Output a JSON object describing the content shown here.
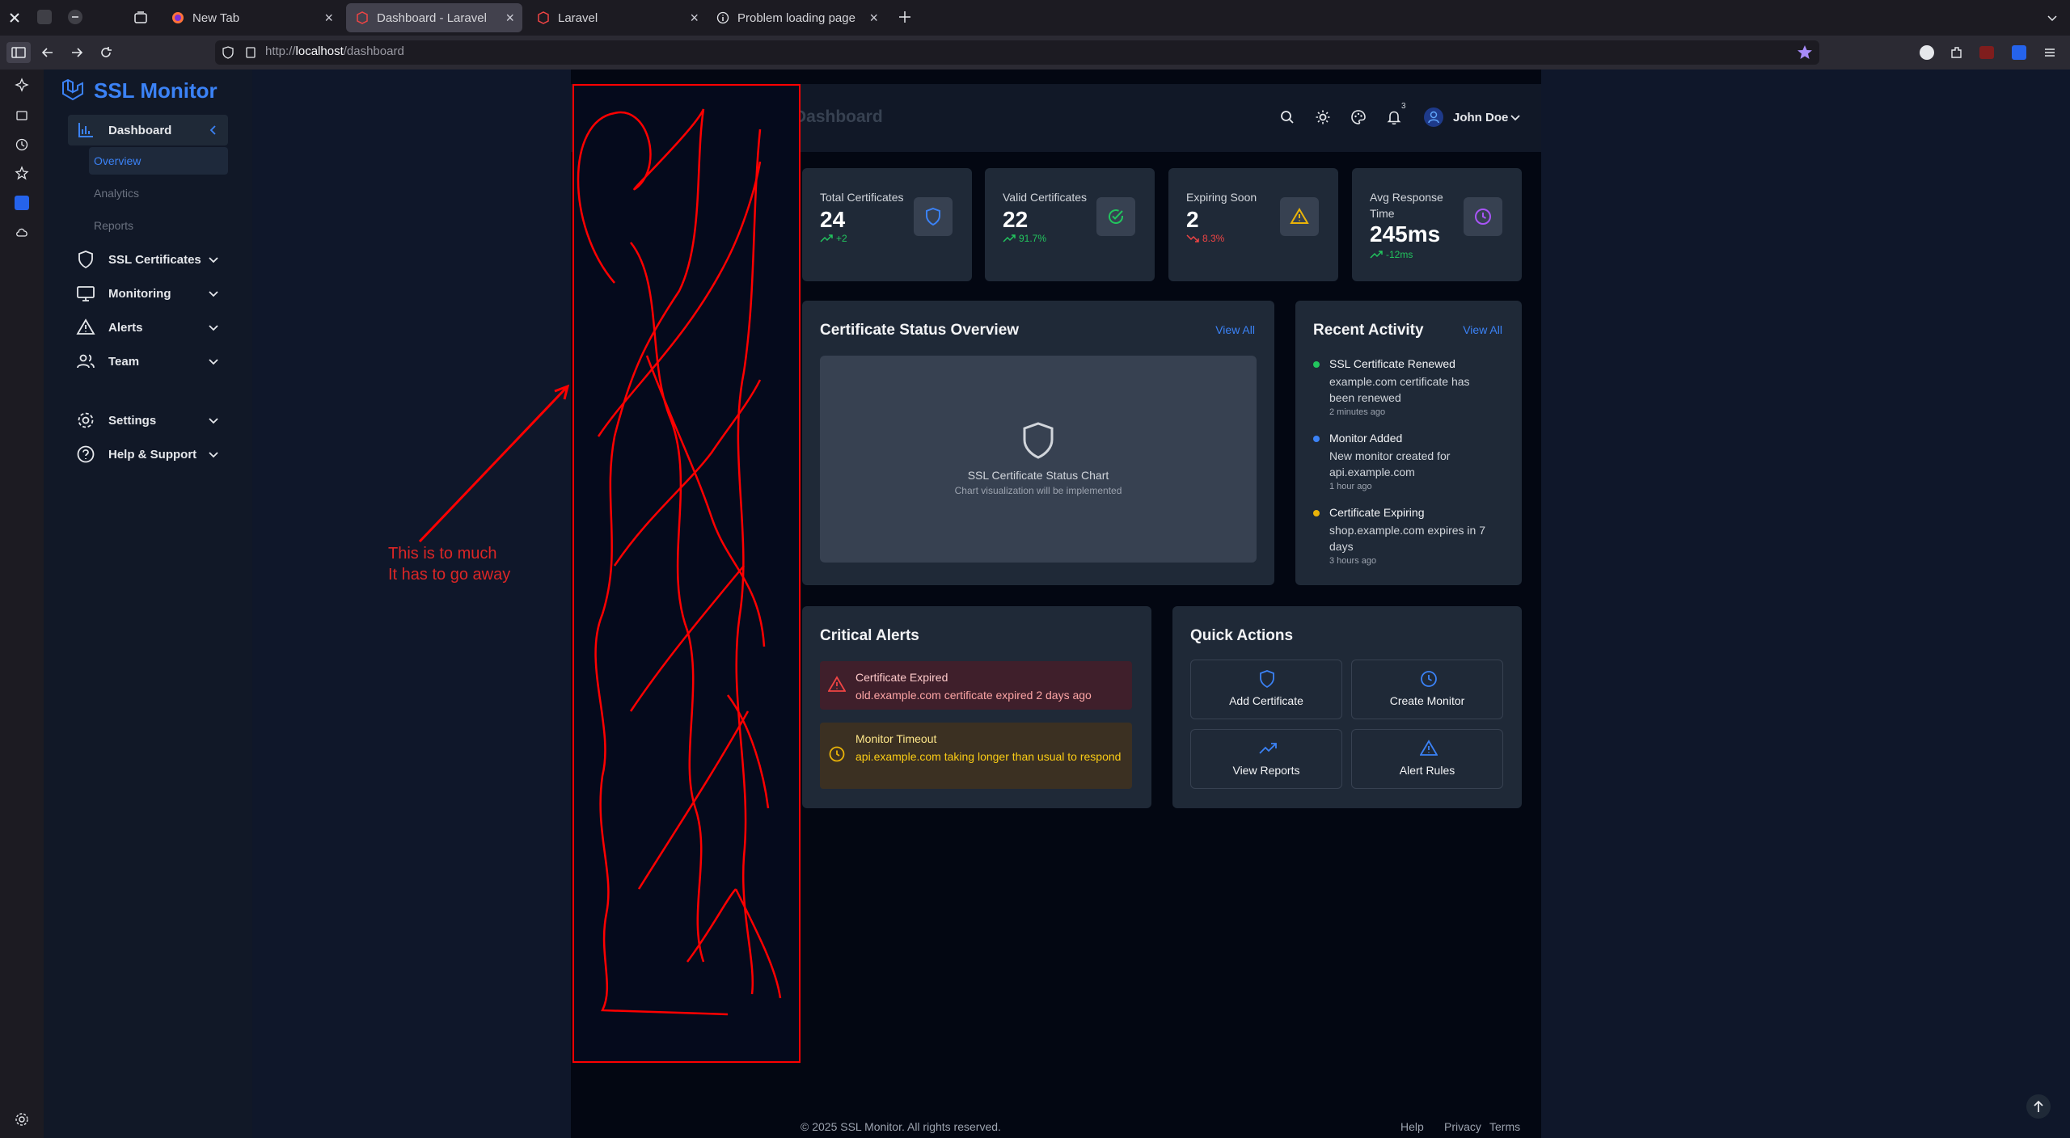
{
  "browser": {
    "tabs": [
      {
        "label": "New Tab"
      },
      {
        "label": "Dashboard - Laravel"
      },
      {
        "label": "Laravel"
      },
      {
        "label": "Problem loading page"
      }
    ],
    "url_scheme": "http://",
    "url_host": "localhost",
    "url_path": "/dashboard"
  },
  "app": {
    "brand": "SSL Monitor",
    "nav": {
      "dashboard": "Dashboard",
      "overview": "Overview",
      "analytics": "Analytics",
      "reports": "Reports",
      "ssl_certificates": "SSL Certificates",
      "monitoring": "Monitoring",
      "alerts": "Alerts",
      "team": "Team",
      "settings": "Settings",
      "help": "Help & Support"
    },
    "header": {
      "title": "Dashboard",
      "notification_count": "3",
      "user_name": "John Doe"
    },
    "stats": [
      {
        "label": "Total Certificates",
        "value": "24",
        "trend": "+2",
        "trend_color": "#22c55e",
        "icon": "shield-icon",
        "icon_color": "#3b82f6"
      },
      {
        "label": "Valid Certificates",
        "value": "22",
        "trend": "91.7%",
        "trend_color": "#22c55e",
        "icon": "check-circle-icon",
        "icon_color": "#22c55e"
      },
      {
        "label": "Expiring Soon",
        "value": "2",
        "trend": "8.3%",
        "trend_color": "#ef4444",
        "icon": "warning-icon",
        "icon_color": "#eab308"
      },
      {
        "label": "Avg Response Time",
        "value": "245ms",
        "trend": "-12ms",
        "trend_color": "#22c55e",
        "icon": "clock-icon",
        "icon_color": "#a855f7"
      }
    ],
    "status_overview": {
      "title": "Certificate Status Overview",
      "view_all": "View All",
      "chart_title": "SSL Certificate Status Chart",
      "chart_subtitle": "Chart visualization will be implemented"
    },
    "recent_activity": {
      "title": "Recent Activity",
      "view_all": "View All",
      "items": [
        {
          "title": "SSL Certificate Renewed",
          "desc": "example.com certificate has been renewed",
          "time": "2 minutes ago",
          "color": "#22c55e"
        },
        {
          "title": "Monitor Added",
          "desc": "New monitor created for api.example.com",
          "time": "1 hour ago",
          "color": "#3b82f6"
        },
        {
          "title": "Certificate Expiring",
          "desc": "shop.example.com expires in 7 days",
          "time": "3 hours ago",
          "color": "#eab308"
        }
      ]
    },
    "critical_alerts": {
      "title": "Critical Alerts",
      "items": [
        {
          "title": "Certificate Expired",
          "desc": "old.example.com certificate expired 2 days ago"
        },
        {
          "title": "Monitor Timeout",
          "desc": "api.example.com taking longer than usual to respond"
        }
      ]
    },
    "quick_actions": {
      "title": "Quick Actions",
      "items": [
        {
          "label": "Add Certificate"
        },
        {
          "label": "Create Monitor"
        },
        {
          "label": "View Reports"
        },
        {
          "label": "Alert Rules"
        }
      ]
    },
    "footer": {
      "copyright": "© 2025 SSL Monitor. All rights reserved.",
      "help": "Help",
      "privacy": "Privacy",
      "terms": "Terms"
    }
  },
  "annotation": {
    "line1": "This is to much",
    "line2": "It has to go away",
    "color": "#ff0000"
  }
}
